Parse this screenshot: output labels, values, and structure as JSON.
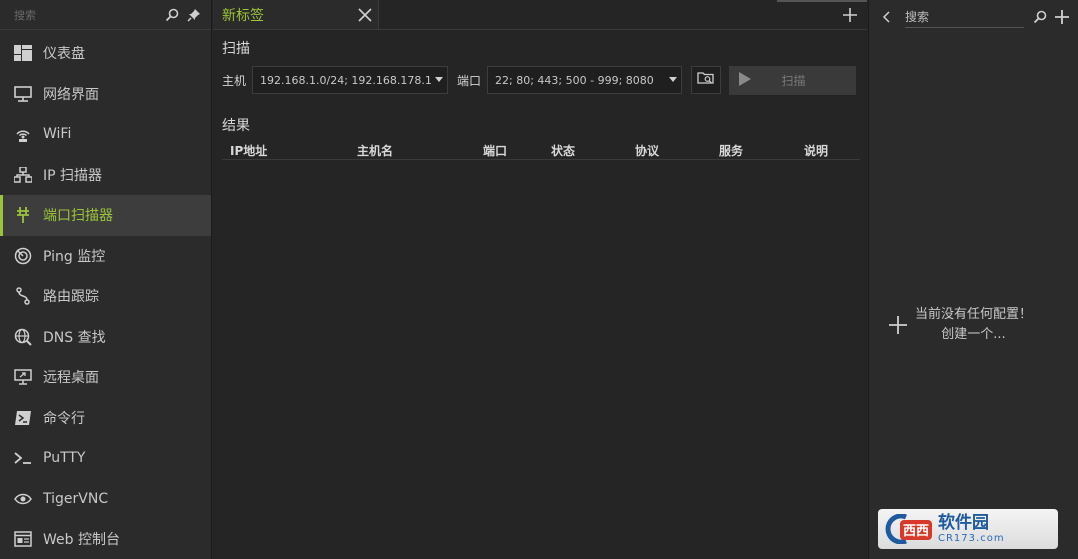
{
  "sidebar": {
    "search_placeholder": "搜索",
    "items": [
      {
        "label": "仪表盘",
        "icon": "dashboard-icon"
      },
      {
        "label": "网络界面",
        "icon": "network-interface-icon"
      },
      {
        "label": "WiFi",
        "icon": "wifi-icon"
      },
      {
        "label": "IP 扫描器",
        "icon": "ip-scanner-icon"
      },
      {
        "label": "端口扫描器",
        "icon": "port-scanner-icon",
        "active": true
      },
      {
        "label": "Ping 监控",
        "icon": "ping-monitor-icon"
      },
      {
        "label": "路由跟踪",
        "icon": "traceroute-icon"
      },
      {
        "label": "DNS 查找",
        "icon": "dns-lookup-icon"
      },
      {
        "label": "远程桌面",
        "icon": "remote-desktop-icon"
      },
      {
        "label": "命令行",
        "icon": "command-line-icon"
      },
      {
        "label": "PuTTY",
        "icon": "putty-icon"
      },
      {
        "label": "TigerVNC",
        "icon": "tigervnc-icon"
      },
      {
        "label": "Web 控制台",
        "icon": "web-console-icon"
      }
    ]
  },
  "tabs": [
    {
      "label": "新标签"
    }
  ],
  "scan": {
    "section_title": "扫描",
    "host_label": "主机",
    "host_value": "192.168.1.0/24; 192.168.178.1 -",
    "port_label": "端口",
    "port_value": "22; 80; 443; 500 - 999; 8080",
    "scan_button": "扫描"
  },
  "results": {
    "section_title": "结果",
    "columns": [
      "IP地址",
      "主机名",
      "端口",
      "状态",
      "协议",
      "服务",
      "说明"
    ]
  },
  "profiles": {
    "search_text": "搜索",
    "empty_line1": "当前没有任何配置！",
    "empty_line2": "创建一个..."
  },
  "watermark": {
    "name": "软件园",
    "site": "CR173.com"
  },
  "colors": {
    "accent": "#9ac43a",
    "background": "#252525",
    "panel": "#2b2b2b"
  }
}
